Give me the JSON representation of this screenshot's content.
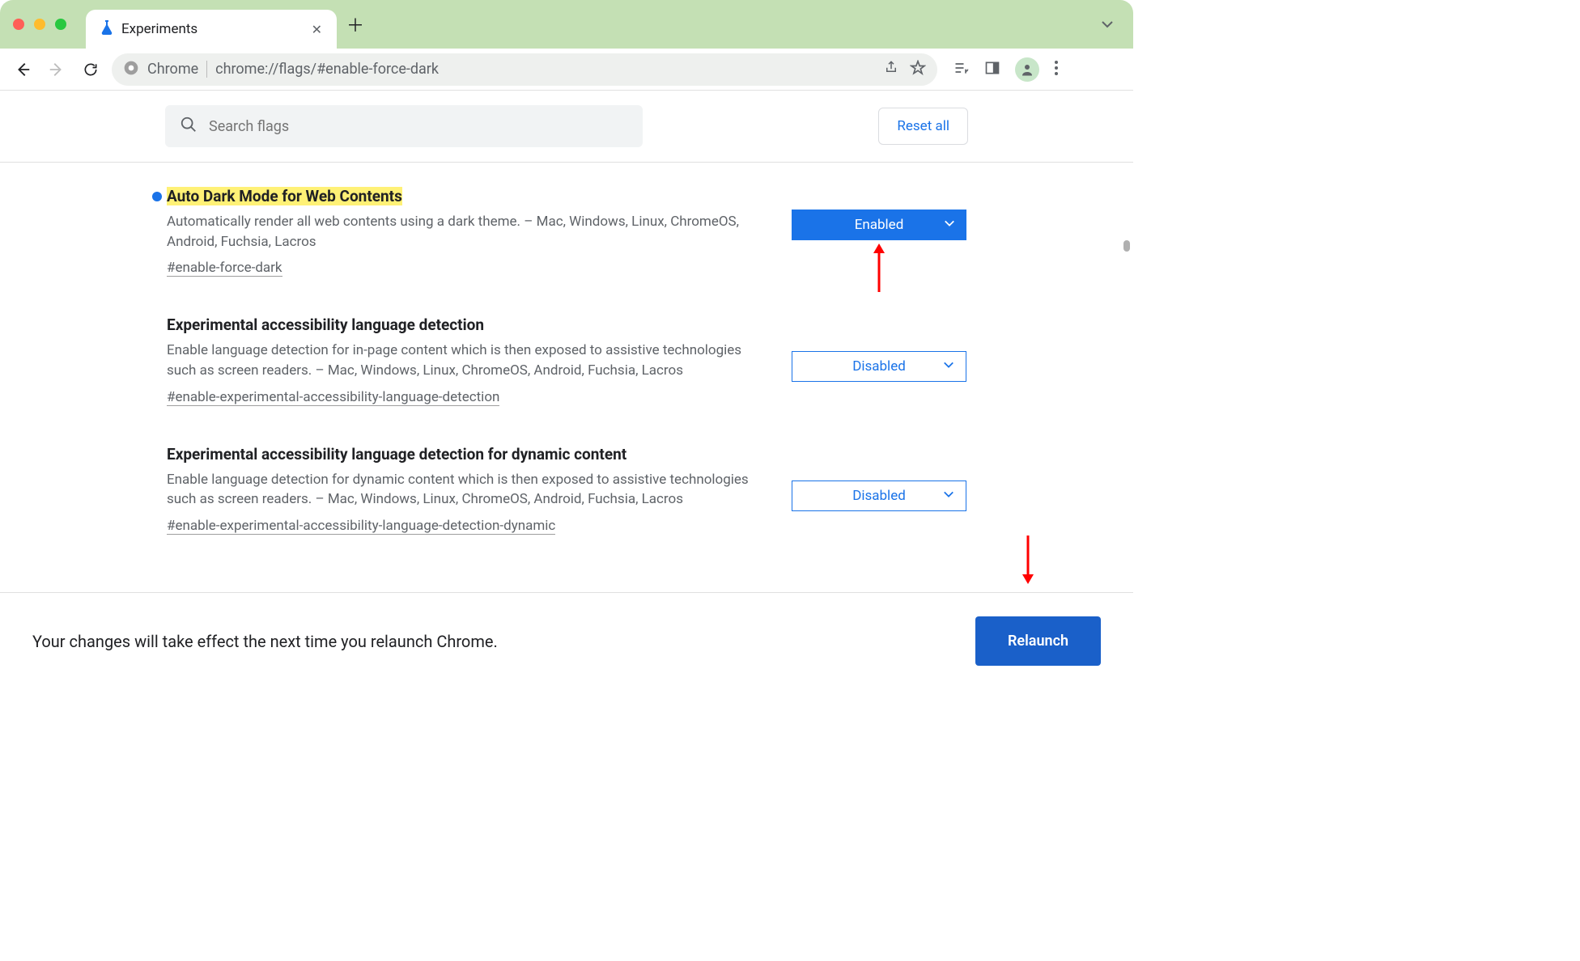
{
  "window": {
    "tab_title": "Experiments",
    "tab_favicon": "flask-icon"
  },
  "addressbar": {
    "site_label": "Chrome",
    "url": "chrome://flags/#enable-force-dark"
  },
  "flagsbar": {
    "search_placeholder": "Search flags",
    "reset_label": "Reset all"
  },
  "flags": [
    {
      "title": "Auto Dark Mode for Web Contents",
      "highlighted": true,
      "bullet": true,
      "description": "Automatically render all web contents using a dark theme. – Mac, Windows, Linux, ChromeOS, Android, Fuchsia, Lacros",
      "anchor": "#enable-force-dark",
      "dropdown_value": "Enabled",
      "dropdown_style": "enabled"
    },
    {
      "title": "Experimental accessibility language detection",
      "highlighted": false,
      "bullet": false,
      "description": "Enable language detection for in-page content which is then exposed to assistive technologies such as screen readers. – Mac, Windows, Linux, ChromeOS, Android, Fuchsia, Lacros",
      "anchor": "#enable-experimental-accessibility-language-detection",
      "dropdown_value": "Disabled",
      "dropdown_style": "normal"
    },
    {
      "title": "Experimental accessibility language detection for dynamic content",
      "highlighted": false,
      "bullet": false,
      "description": "Enable language detection for dynamic content which is then exposed to assistive technologies such as screen readers. – Mac, Windows, Linux, ChromeOS, Android, Fuchsia, Lacros",
      "anchor": "#enable-experimental-accessibility-language-detection-dynamic",
      "dropdown_value": "Disabled",
      "dropdown_style": "normal"
    }
  ],
  "banner": {
    "message": "Your changes will take effect the next time you relaunch Chrome.",
    "button": "Relaunch"
  },
  "colors": {
    "accent": "#1a73e8",
    "window_bg": "#c4e0b4",
    "highlight": "#fff176",
    "arrow": "#ff0000"
  }
}
